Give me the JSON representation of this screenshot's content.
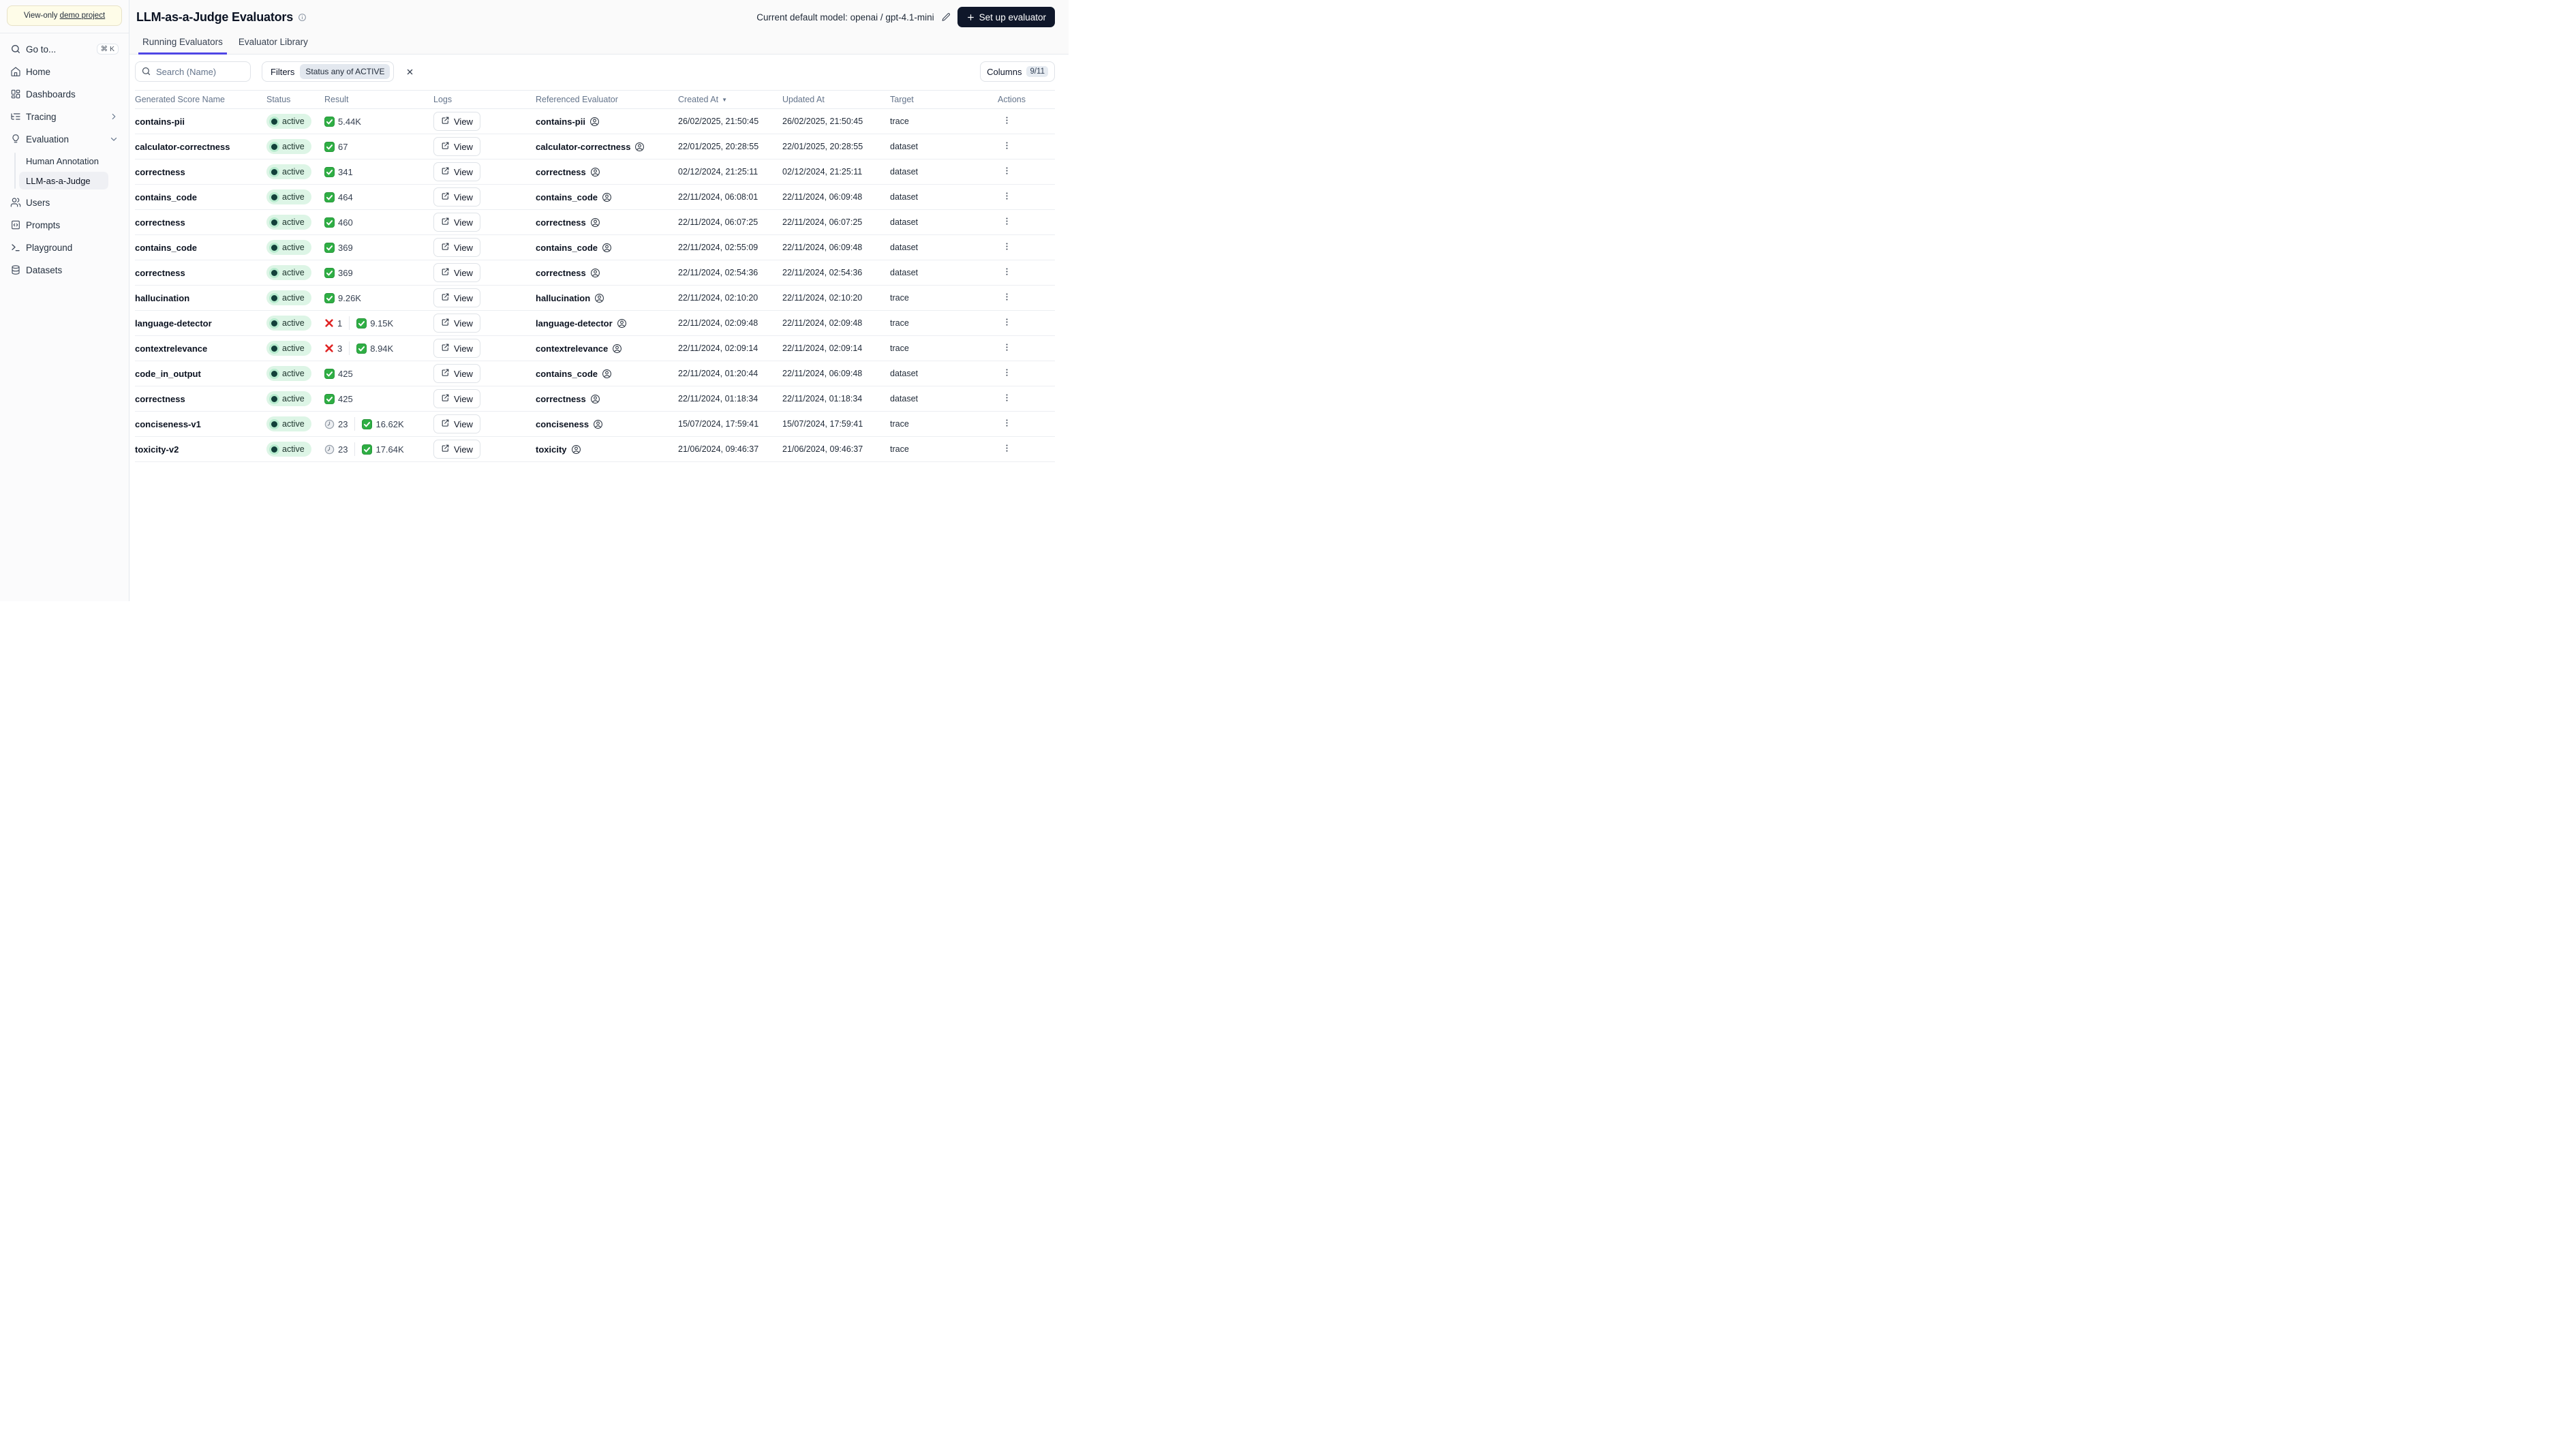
{
  "sidebar": {
    "banner": {
      "prefix": "View-only ",
      "link": "demo project"
    },
    "items": [
      {
        "id": "goto",
        "label": "Go to...",
        "icon": "search-icon",
        "shortcut": "⌘ K"
      },
      {
        "id": "home",
        "label": "Home",
        "icon": "home-icon"
      },
      {
        "id": "dashboards",
        "label": "Dashboards",
        "icon": "dashboards-icon"
      },
      {
        "id": "tracing",
        "label": "Tracing",
        "icon": "tracing-icon",
        "chevron": "right"
      },
      {
        "id": "evaluation",
        "label": "Evaluation",
        "icon": "evaluation-icon",
        "chevron": "down",
        "children": [
          {
            "id": "human-annotation",
            "label": "Human Annotation",
            "selected": false
          },
          {
            "id": "llm-as-a-judge",
            "label": "LLM-as-a-Judge",
            "selected": true
          }
        ]
      },
      {
        "id": "users",
        "label": "Users",
        "icon": "users-icon"
      },
      {
        "id": "prompts",
        "label": "Prompts",
        "icon": "prompts-icon"
      },
      {
        "id": "playground",
        "label": "Playground",
        "icon": "playground-icon"
      },
      {
        "id": "datasets",
        "label": "Datasets",
        "icon": "datasets-icon"
      }
    ]
  },
  "header": {
    "title": "LLM-as-a-Judge Evaluators",
    "model_label": "Current default model: openai / gpt-4.1-mini",
    "setup_button": "Set up evaluator"
  },
  "tabs": [
    {
      "label": "Running Evaluators",
      "active": true
    },
    {
      "label": "Evaluator Library",
      "active": false
    }
  ],
  "toolbar": {
    "search_placeholder": "Search (Name)",
    "filters_label": "Filters",
    "filter_chip": "Status any of ACTIVE",
    "columns_label": "Columns",
    "columns_count": "9/11"
  },
  "table": {
    "columns": [
      "Generated Score Name",
      "Status",
      "Result",
      "Logs",
      "Referenced Evaluator",
      "Created At",
      "Updated At",
      "Target",
      "Actions"
    ],
    "sort_column": "Created At",
    "sort_indicator": "▼",
    "view_label": "View",
    "rows": [
      {
        "name": "contains-pii",
        "status": "active",
        "result": [
          {
            "icon": "check",
            "value": "5.44K"
          }
        ],
        "referenced": "contains-pii",
        "created": "26/02/2025, 21:50:45",
        "updated": "26/02/2025, 21:50:45",
        "target": "trace"
      },
      {
        "name": "calculator-correctness",
        "status": "active",
        "result": [
          {
            "icon": "check",
            "value": "67"
          }
        ],
        "referenced": "calculator-correctness",
        "created": "22/01/2025, 20:28:55",
        "updated": "22/01/2025, 20:28:55",
        "target": "dataset"
      },
      {
        "name": "correctness",
        "status": "active",
        "result": [
          {
            "icon": "check",
            "value": "341"
          }
        ],
        "referenced": "correctness",
        "created": "02/12/2024, 21:25:11",
        "updated": "02/12/2024, 21:25:11",
        "target": "dataset"
      },
      {
        "name": "contains_code",
        "status": "active",
        "result": [
          {
            "icon": "check",
            "value": "464"
          }
        ],
        "referenced": "contains_code",
        "created": "22/11/2024, 06:08:01",
        "updated": "22/11/2024, 06:09:48",
        "target": "dataset"
      },
      {
        "name": "correctness",
        "status": "active",
        "result": [
          {
            "icon": "check",
            "value": "460"
          }
        ],
        "referenced": "correctness",
        "created": "22/11/2024, 06:07:25",
        "updated": "22/11/2024, 06:07:25",
        "target": "dataset"
      },
      {
        "name": "contains_code",
        "status": "active",
        "result": [
          {
            "icon": "check",
            "value": "369"
          }
        ],
        "referenced": "contains_code",
        "created": "22/11/2024, 02:55:09",
        "updated": "22/11/2024, 06:09:48",
        "target": "dataset"
      },
      {
        "name": "correctness",
        "status": "active",
        "result": [
          {
            "icon": "check",
            "value": "369"
          }
        ],
        "referenced": "correctness",
        "created": "22/11/2024, 02:54:36",
        "updated": "22/11/2024, 02:54:36",
        "target": "dataset"
      },
      {
        "name": "hallucination",
        "status": "active",
        "result": [
          {
            "icon": "check",
            "value": "9.26K"
          }
        ],
        "referenced": "hallucination",
        "created": "22/11/2024, 02:10:20",
        "updated": "22/11/2024, 02:10:20",
        "target": "trace"
      },
      {
        "name": "language-detector",
        "status": "active",
        "result": [
          {
            "icon": "error",
            "value": "1"
          },
          {
            "icon": "check",
            "value": "9.15K"
          }
        ],
        "referenced": "language-detector",
        "created": "22/11/2024, 02:09:48",
        "updated": "22/11/2024, 02:09:48",
        "target": "trace"
      },
      {
        "name": "contextrelevance",
        "status": "active",
        "result": [
          {
            "icon": "error",
            "value": "3"
          },
          {
            "icon": "check",
            "value": "8.94K"
          }
        ],
        "referenced": "contextrelevance",
        "created": "22/11/2024, 02:09:14",
        "updated": "22/11/2024, 02:09:14",
        "target": "trace"
      },
      {
        "name": "code_in_output",
        "status": "active",
        "result": [
          {
            "icon": "check",
            "value": "425"
          }
        ],
        "referenced": "contains_code",
        "created": "22/11/2024, 01:20:44",
        "updated": "22/11/2024, 06:09:48",
        "target": "dataset"
      },
      {
        "name": "correctness",
        "status": "active",
        "result": [
          {
            "icon": "check",
            "value": "425"
          }
        ],
        "referenced": "correctness",
        "created": "22/11/2024, 01:18:34",
        "updated": "22/11/2024, 01:18:34",
        "target": "dataset"
      },
      {
        "name": "conciseness-v1",
        "status": "active",
        "result": [
          {
            "icon": "pending",
            "value": "23"
          },
          {
            "icon": "check",
            "value": "16.62K"
          }
        ],
        "referenced": "conciseness",
        "created": "15/07/2024, 17:59:41",
        "updated": "15/07/2024, 17:59:41",
        "target": "trace"
      },
      {
        "name": "toxicity-v2",
        "status": "active",
        "result": [
          {
            "icon": "pending",
            "value": "23"
          },
          {
            "icon": "check",
            "value": "17.64K"
          }
        ],
        "referenced": "toxicity",
        "created": "21/06/2024, 09:46:37",
        "updated": "21/06/2024, 09:46:37",
        "target": "trace"
      }
    ]
  },
  "colors": {
    "accent": "#4f46e5",
    "primary_button_bg": "#0f172a",
    "status_badge_bg": "#ddf5e6",
    "status_dot": "#12403a",
    "check_green": "#2fae44",
    "error_red": "#e02424",
    "banner_bg": "#fefce8",
    "sidebar_bg": "#fbfbfc"
  }
}
